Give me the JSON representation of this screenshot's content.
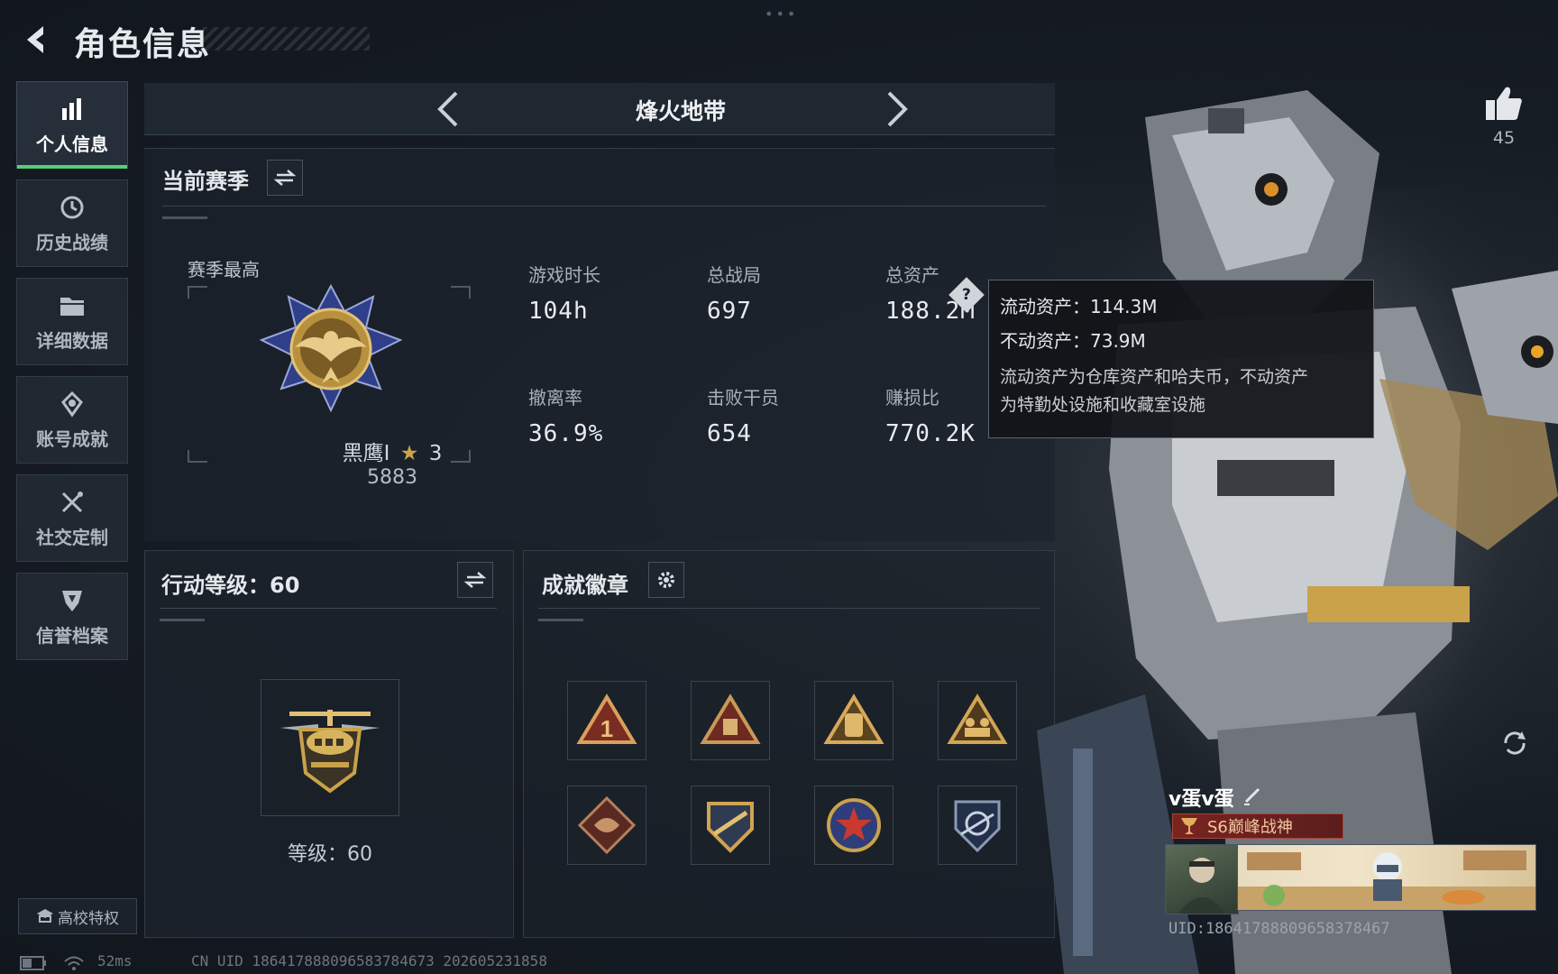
{
  "header": {
    "title": "角色信息"
  },
  "sidebar": {
    "items": [
      {
        "label": "个人信息",
        "icon": "bar-chart-icon",
        "active": true
      },
      {
        "label": "历史战绩",
        "icon": "history-clock-icon",
        "active": false
      },
      {
        "label": "详细数据",
        "icon": "folder-icon",
        "active": false
      },
      {
        "label": "账号成就",
        "icon": "achievement-icon",
        "active": false
      },
      {
        "label": "社交定制",
        "icon": "tools-icon",
        "active": false
      },
      {
        "label": "信誉档案",
        "icon": "shield-icon",
        "active": false
      }
    ],
    "campus_label": "高校特权"
  },
  "mode": {
    "title": "烽火地带"
  },
  "season": {
    "title": "当前赛季",
    "high_label": "赛季最高",
    "rank_name": "黑鹰I",
    "rank_stars": "3",
    "rank_points": "5883",
    "stats": [
      {
        "label": "游戏时长",
        "value": "104h"
      },
      {
        "label": "总战局",
        "value": "697"
      },
      {
        "label": "总资产",
        "value": "188.2M"
      },
      {
        "label": "撤离率",
        "value": "36.9%"
      },
      {
        "label": "击败干员",
        "value": "654"
      },
      {
        "label": "赚损比",
        "value": "770.2K"
      }
    ]
  },
  "tooltip": {
    "liquid": "流动资产：114.3M",
    "fixed": "不动资产：73.9M",
    "desc_line1": "流动资产为仓库资产和哈夫币，不动资产",
    "desc_line2": "为特勤处设施和收藏室设施"
  },
  "action": {
    "title": "行动等级：60",
    "level_text": "等级：60"
  },
  "badges": {
    "title": "成就徽章",
    "items": [
      "badge-1",
      "badge-2",
      "badge-3",
      "badge-4",
      "badge-5",
      "badge-6",
      "badge-7",
      "badge-8"
    ]
  },
  "player": {
    "likes": "45",
    "name": "v蛋v蛋",
    "title_badge": "S6巅峰战神",
    "uid_line": "UID:18641788809658378467"
  },
  "statusbar": {
    "ping": "52ms",
    "cn_uid": "CN UID 186417888096583784673 202605231858"
  },
  "colors": {
    "accent_green": "#4fd17a",
    "gold": "#c9a24a",
    "title_red": "#7a2420"
  }
}
